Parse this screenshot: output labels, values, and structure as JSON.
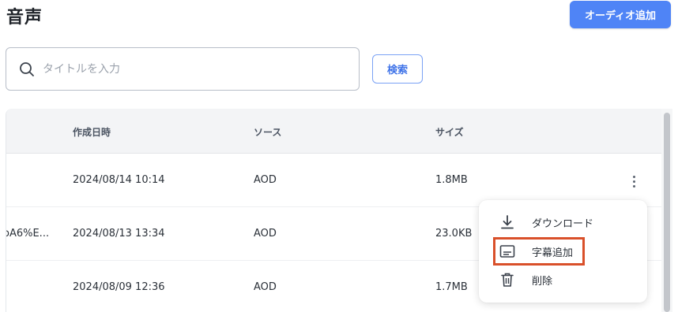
{
  "header": {
    "title": "音声",
    "add_button_label": "オーディオ追加"
  },
  "search": {
    "placeholder": "タイトルを入力",
    "value": "",
    "button_label": "検索"
  },
  "table": {
    "columns": [
      "作成日時",
      "ソース",
      "サイズ"
    ],
    "rows": [
      {
        "name": "",
        "created": "2024/08/14 10:14",
        "source": "AOD",
        "size": "1.8MB"
      },
      {
        "name": "oA6%E...",
        "created": "2024/08/13 13:34",
        "source": "AOD",
        "size": "23.0KB"
      },
      {
        "name": "",
        "created": "2024/08/09 12:36",
        "source": "AOD",
        "size": "1.7MB"
      }
    ]
  },
  "context_menu": {
    "items": [
      {
        "label": "ダウンロード",
        "icon": "download-icon"
      },
      {
        "label": "字幕追加",
        "icon": "subtitles-icon"
      },
      {
        "label": "削除",
        "icon": "trash-icon"
      }
    ],
    "highlighted_index": 1
  },
  "colors": {
    "primary": "#4f84f6",
    "highlight_border": "#d9502a"
  }
}
